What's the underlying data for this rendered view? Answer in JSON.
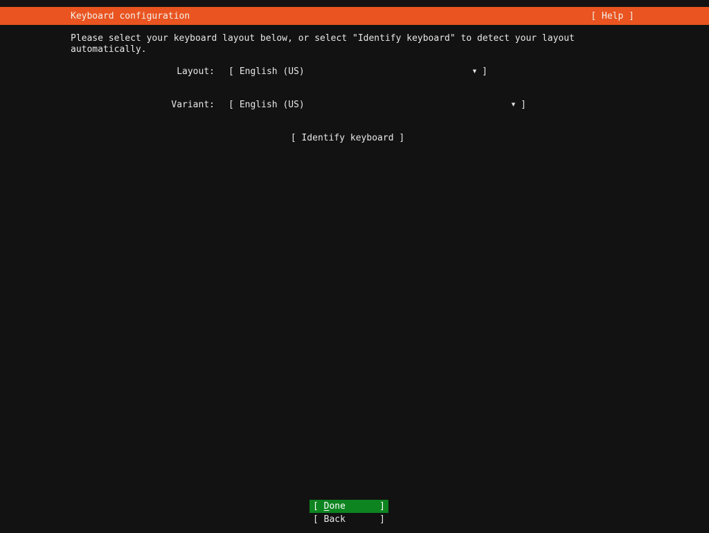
{
  "header": {
    "title": "Keyboard configuration",
    "help_label": "[ Help ]"
  },
  "instructions": "Please select your keyboard layout below, or select \"Identify keyboard\" to detect your layout automatically.",
  "form": {
    "layout": {
      "label": "Layout:",
      "open_bracket": "[",
      "value": "English (US)",
      "arrow_icon": "▼",
      "close_bracket": "]"
    },
    "variant": {
      "label": "Variant:",
      "open_bracket": "[",
      "value": "English (US)",
      "arrow_icon": "▼",
      "close_bracket": "]"
    },
    "identify_button_label": "[ Identify keyboard ]"
  },
  "buttons": {
    "done": {
      "open": "[",
      "accel": "D",
      "rest": "one",
      "close": "]"
    },
    "back": {
      "open": "[",
      "label": "Back",
      "close": "]"
    }
  },
  "colors": {
    "background": "#121212",
    "header_bg": "#e95420",
    "header_text": "#f4f1ec",
    "text": "#e8e8e8",
    "done_bg": "#0e8420",
    "done_text": "#ffffff"
  }
}
